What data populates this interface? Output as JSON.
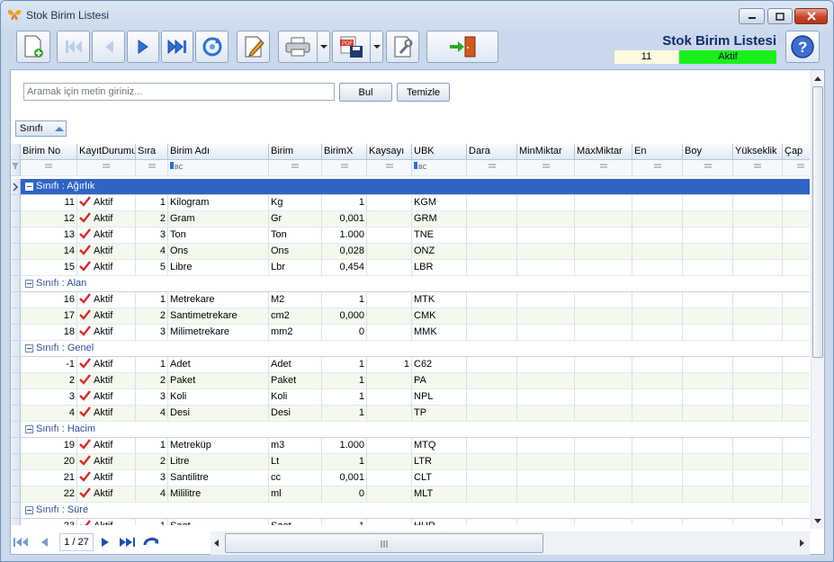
{
  "window": {
    "title": "Stok Birim Listesi"
  },
  "header": {
    "form_title": "Stok Birim Listesi",
    "record_count": "11",
    "status": "Aktif",
    "status_color": "#19f01a"
  },
  "search": {
    "placeholder": "Aramak için metin giriniz...",
    "value": "",
    "find_label": "Bul",
    "clear_label": "Temizle"
  },
  "group_chip": {
    "label": "Sınıfı"
  },
  "columns": [
    "Birim No",
    "KayıtDurumu",
    "Sıra",
    "Birim Adı",
    "Birim",
    "BirimX",
    "Kaysayı",
    "UBK",
    "Dara",
    "MinMiktar",
    "MaxMiktar",
    "En",
    "Boy",
    "Yükseklik",
    "Çap"
  ],
  "groups": [
    {
      "label": "Sınıfı : Ağırlık",
      "rows": [
        {
          "no": "11",
          "status": "Aktif",
          "sira": "1",
          "ad": "Kilogram",
          "birim": "Kg",
          "birimx": "1",
          "kaysayi": "",
          "ubk": "KGM"
        },
        {
          "no": "12",
          "status": "Aktif",
          "sira": "2",
          "ad": "Gram",
          "birim": "Gr",
          "birimx": "0,001",
          "kaysayi": "",
          "ubk": "GRM"
        },
        {
          "no": "13",
          "status": "Aktif",
          "sira": "3",
          "ad": "Ton",
          "birim": "Ton",
          "birimx": "1.000",
          "kaysayi": "",
          "ubk": "TNE"
        },
        {
          "no": "14",
          "status": "Aktif",
          "sira": "4",
          "ad": "Ons",
          "birim": "Ons",
          "birimx": "0,028",
          "kaysayi": "",
          "ubk": "ONZ"
        },
        {
          "no": "15",
          "status": "Aktif",
          "sira": "5",
          "ad": "Libre",
          "birim": "Lbr",
          "birimx": "0,454",
          "kaysayi": "",
          "ubk": "LBR"
        }
      ]
    },
    {
      "label": "Sınıfı : Alan",
      "rows": [
        {
          "no": "16",
          "status": "Aktif",
          "sira": "1",
          "ad": "Metrekare",
          "birim": "M2",
          "birimx": "1",
          "kaysayi": "",
          "ubk": "MTK"
        },
        {
          "no": "17",
          "status": "Aktif",
          "sira": "2",
          "ad": "Santimetrekare",
          "birim": "cm2",
          "birimx": "0,000",
          "kaysayi": "",
          "ubk": "CMK"
        },
        {
          "no": "18",
          "status": "Aktif",
          "sira": "3",
          "ad": "Milimetrekare",
          "birim": "mm2",
          "birimx": "0",
          "kaysayi": "",
          "ubk": "MMK"
        }
      ]
    },
    {
      "label": "Sınıfı : Genel",
      "rows": [
        {
          "no": "-1",
          "status": "Aktif",
          "sira": "1",
          "ad": "Adet",
          "birim": "Adet",
          "birimx": "1",
          "kaysayi": "1",
          "ubk": "C62"
        },
        {
          "no": "2",
          "status": "Aktif",
          "sira": "2",
          "ad": "Paket",
          "birim": "Paket",
          "birimx": "1",
          "kaysayi": "",
          "ubk": "PA"
        },
        {
          "no": "3",
          "status": "Aktif",
          "sira": "3",
          "ad": "Koli",
          "birim": "Koli",
          "birimx": "1",
          "kaysayi": "",
          "ubk": "NPL"
        },
        {
          "no": "4",
          "status": "Aktif",
          "sira": "4",
          "ad": "Desi",
          "birim": "Desi",
          "birimx": "1",
          "kaysayi": "",
          "ubk": "TP"
        }
      ]
    },
    {
      "label": "Sınıfı : Hacim",
      "rows": [
        {
          "no": "19",
          "status": "Aktif",
          "sira": "1",
          "ad": "Metreküp",
          "birim": "m3",
          "birimx": "1.000",
          "kaysayi": "",
          "ubk": "MTQ"
        },
        {
          "no": "20",
          "status": "Aktif",
          "sira": "2",
          "ad": "Litre",
          "birim": "Lt",
          "birimx": "1",
          "kaysayi": "",
          "ubk": "LTR"
        },
        {
          "no": "21",
          "status": "Aktif",
          "sira": "3",
          "ad": "Santilitre",
          "birim": "cc",
          "birimx": "0,001",
          "kaysayi": "",
          "ubk": "CLT"
        },
        {
          "no": "22",
          "status": "Aktif",
          "sira": "4",
          "ad": "Mililitre",
          "birim": "ml",
          "birimx": "0",
          "kaysayi": "",
          "ubk": "MLT"
        }
      ]
    },
    {
      "label": "Sınıfı : Süre",
      "rows": [
        {
          "no": "23",
          "status": "Aktif",
          "sira": "1",
          "ad": "Saat",
          "birim": "Saat",
          "birimx": "1",
          "kaysayi": "",
          "ubk": "HUR"
        }
      ]
    }
  ],
  "pager": {
    "page_text": "1 / 27"
  },
  "colors": {
    "selected_group": "#2f64c6",
    "check": "#d42a2a",
    "title": "#102a6b"
  }
}
